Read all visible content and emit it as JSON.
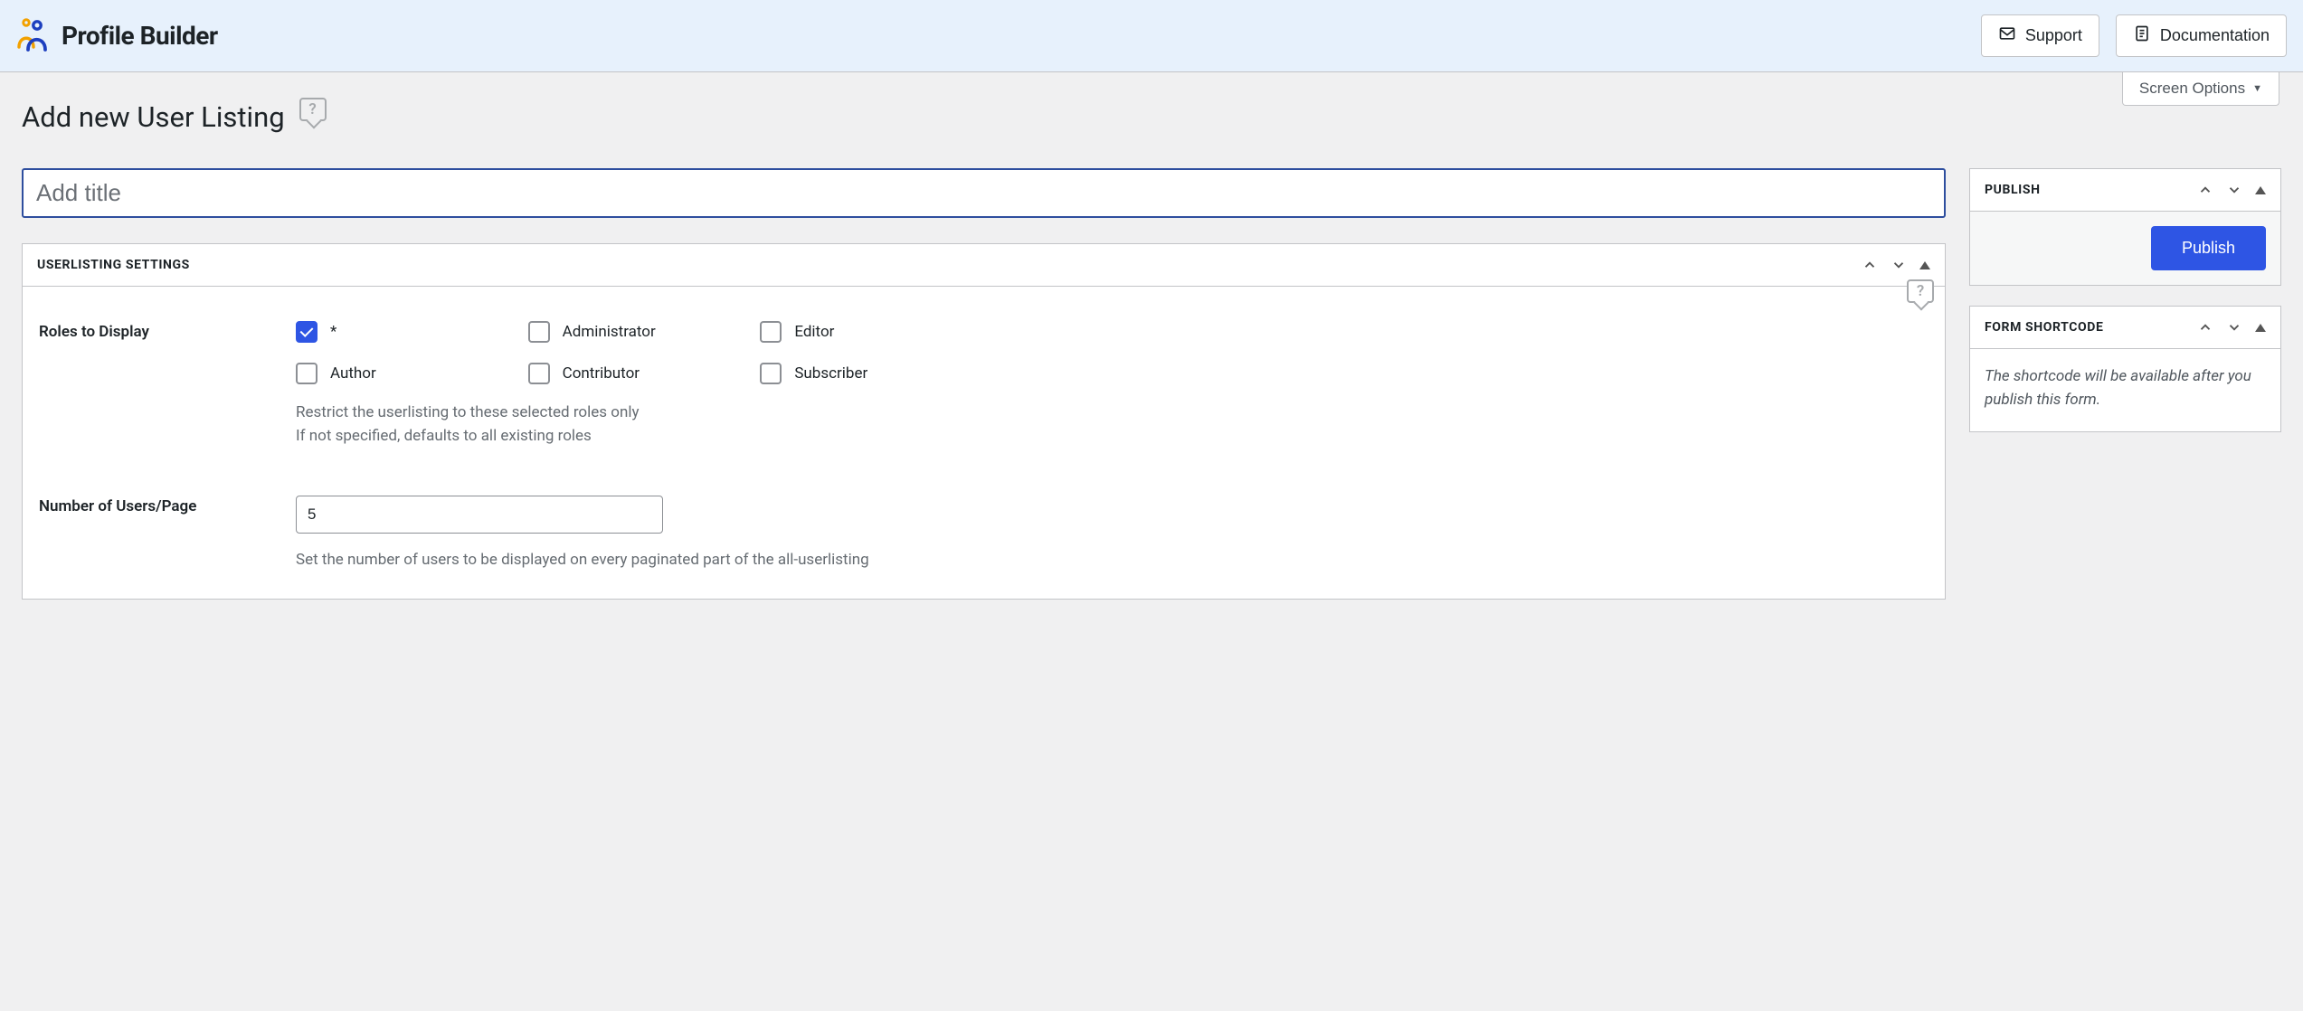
{
  "header": {
    "brand": "Profile Builder",
    "support_label": "Support",
    "documentation_label": "Documentation"
  },
  "screen_options_label": "Screen Options",
  "page_title": "Add new User Listing",
  "title_placeholder": "Add title",
  "settings_box": {
    "title": "USERLISTING SETTINGS",
    "roles_label": "Roles to Display",
    "roles": [
      {
        "label": "*",
        "checked": true
      },
      {
        "label": "Administrator",
        "checked": false
      },
      {
        "label": "Editor",
        "checked": false
      },
      {
        "label": "Author",
        "checked": false
      },
      {
        "label": "Contributor",
        "checked": false
      },
      {
        "label": "Subscriber",
        "checked": false
      }
    ],
    "roles_desc_1": "Restrict the userlisting to these selected roles only",
    "roles_desc_2": "If not specified, defaults to all existing roles",
    "users_per_page_label": "Number of Users/Page",
    "users_per_page_value": "5",
    "users_per_page_desc": "Set the number of users to be displayed on every paginated part of the all-userlisting"
  },
  "publish_box": {
    "title": "PUBLISH",
    "button_label": "Publish"
  },
  "shortcode_box": {
    "title": "FORM SHORTCODE",
    "message": "The shortcode will be available after you publish this form."
  }
}
